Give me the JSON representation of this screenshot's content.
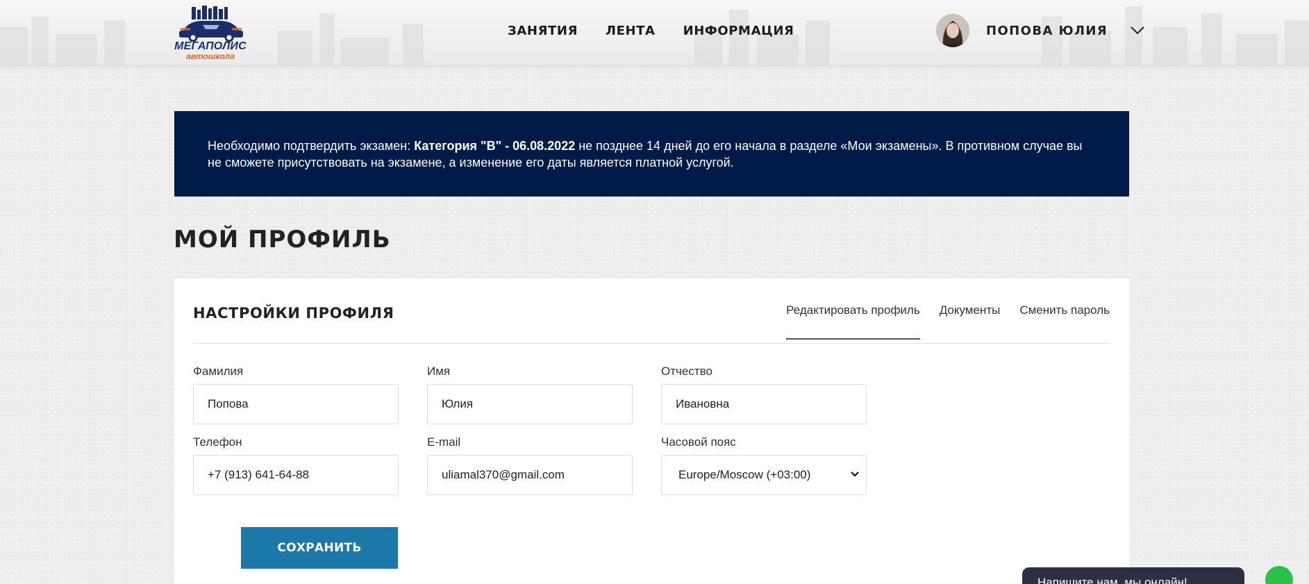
{
  "header": {
    "logo": {
      "line1": "МЕГАПОЛИС",
      "line2": "автошкола"
    },
    "nav": [
      "ЗАНЯТИЯ",
      "ЛЕНТА",
      "ИНФОРМАЦИЯ"
    ],
    "user": {
      "name": "ПОПОВА ЮЛИЯ"
    }
  },
  "banner": {
    "prefix": "Необходимо подтвердить экзамен: ",
    "exam": "Категория \"B\" - 06.08.2022",
    "suffix": " не позднее 14 дней до его начала в разделе «Мои экзамены». В противном случае вы не сможете присутствовать на экзамене, а изменение его даты является платной услугой."
  },
  "page_title": "МОЙ ПРОФИЛЬ",
  "card": {
    "title": "НАСТРОЙКИ ПРОФИЛЯ",
    "tabs": [
      {
        "label": "Редактировать профиль",
        "active": true
      },
      {
        "label": "Документы",
        "active": false
      },
      {
        "label": "Сменить пароль",
        "active": false
      }
    ],
    "fields": {
      "last_name": {
        "label": "Фамилия",
        "value": "Попова"
      },
      "first_name": {
        "label": "Имя",
        "value": "Юлия"
      },
      "middle_name": {
        "label": "Отчество",
        "value": "Ивановна"
      },
      "phone": {
        "label": "Телефон",
        "value": "+7 (913) 641-64-88"
      },
      "email": {
        "label": "E-mail",
        "value": "uliamal370@gmail.com"
      },
      "timezone": {
        "label": "Часовой пояс",
        "value": "Europe/Moscow (+03:00)"
      }
    },
    "save_label": "СОХРАНИТЬ"
  },
  "chat": {
    "label": "Напишите нам, мы онлайн!"
  },
  "colors": {
    "banner_bg": "#001a48",
    "button_bg": "#1c78a9",
    "logo_blue": "#1b2d6b",
    "logo_orange": "#e0672a",
    "chat_bg": "#2d2f42",
    "chat_icon": "#2bc04a"
  }
}
